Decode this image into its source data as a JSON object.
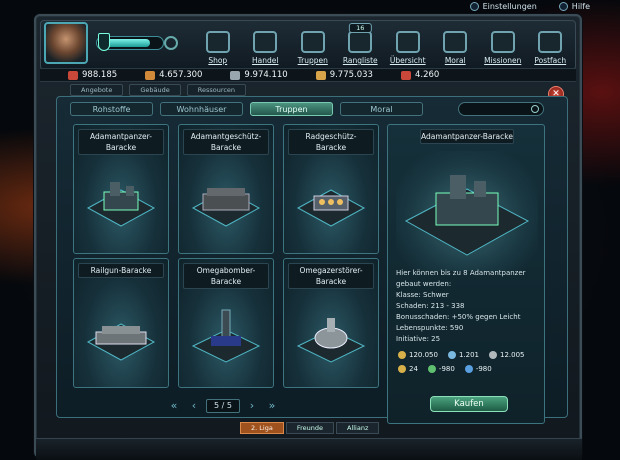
{
  "toplinks": {
    "settings": "Einstellungen",
    "help": "Hilfe"
  },
  "header": {
    "energy_fraction": 0.78,
    "nav": [
      {
        "label": "Shop"
      },
      {
        "label": "Handel"
      },
      {
        "label": "Truppen"
      },
      {
        "label": "Rangliste",
        "badge": "16"
      },
      {
        "label": "Übersicht"
      },
      {
        "label": "Moral"
      },
      {
        "label": "Missionen"
      },
      {
        "label": "Postfach"
      }
    ]
  },
  "resources": [
    {
      "value": "988.185",
      "color": "#c9483a"
    },
    {
      "value": "4.657.300",
      "color": "#d08a3a"
    },
    {
      "value": "9.974.110",
      "color": "#9aa6ae"
    },
    {
      "value": "9.775.033",
      "color": "#d8a44a"
    },
    {
      "value": "4.260",
      "color": "#c9483a"
    }
  ],
  "subtabs": [
    "Angebote",
    "Gebäude",
    "Ressourcen"
  ],
  "categories": [
    {
      "label": "Rohstoffe",
      "active": false
    },
    {
      "label": "Wohnhäuser",
      "active": false
    },
    {
      "label": "Truppen",
      "active": true
    },
    {
      "label": "Moral",
      "active": false
    }
  ],
  "buildings": [
    {
      "name": "Adamantpanzer-Baracke",
      "icon": "tank-barracks-icon"
    },
    {
      "name": "Adamantgeschütz-Baracke",
      "icon": "artillery-barracks-icon"
    },
    {
      "name": "Radgeschütz-Baracke",
      "icon": "wheel-gun-barracks-icon"
    },
    {
      "name": "Railgun-Baracke",
      "icon": "railgun-barracks-icon"
    },
    {
      "name": "Omegabomber-Baracke",
      "icon": "bomber-barracks-icon"
    },
    {
      "name": "Omegazerstörer-Baracke",
      "icon": "destroyer-barracks-icon"
    }
  ],
  "detail": {
    "title": "Adamantpanzer-Baracke",
    "lines": [
      "Hier können bis zu 8 Adamantpanzer",
      "gebaut werden:",
      "Klasse: Schwer",
      "Schaden: 213 - 338",
      "Bonusschaden: +50% gegen Leicht",
      "Lebenspunkte: 590",
      "Initiative: 25"
    ],
    "costs": [
      {
        "value": "120.050",
        "color": "#d8b04a"
      },
      {
        "value": "1.201",
        "color": "#7ab8e0"
      },
      {
        "value": "12.005",
        "color": "#b0b8bc"
      }
    ],
    "effects": [
      {
        "value": "24",
        "color": "#d8b04a"
      },
      {
        "value": "-980",
        "color": "#5fc070"
      },
      {
        "value": "-980",
        "color": "#5aa0e0"
      }
    ],
    "buy_label": "Kaufen"
  },
  "pager": {
    "text": "5 / 5"
  },
  "bottom_tabs": [
    {
      "label": "2. Liga",
      "active": true
    },
    {
      "label": "Freunde",
      "active": false
    },
    {
      "label": "Allianz",
      "active": false
    }
  ]
}
